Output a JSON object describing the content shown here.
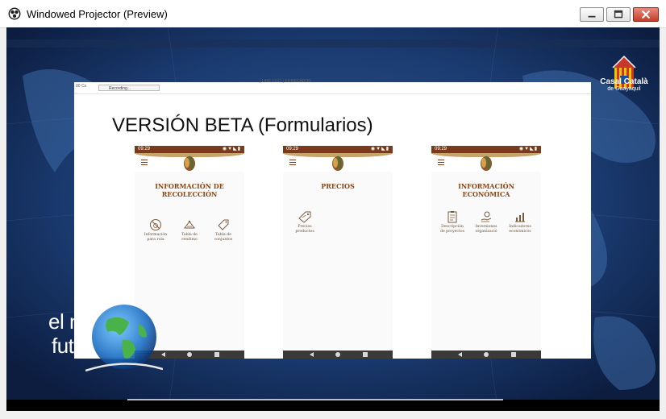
{
  "window": {
    "title": "Windowed Projector (Preview)",
    "controls": [
      "minimize-icon",
      "maximize-icon",
      "close-icon"
    ]
  },
  "slide": {
    "toolbar": {
      "left_text": "00 Cs",
      "recording_label": "Recording...",
      "top_text": "| LINE 11111 | F0 RECADOR"
    },
    "title": "VERSIÓN BETA (Formularios)"
  },
  "phones": [
    {
      "status_time": "09:29",
      "screen_title_line1": "INFORMACIÓN DE",
      "screen_title_line2": "RECOLECCIÓN",
      "items": [
        {
          "icon": "no-fruit-icon",
          "line1": "Información",
          "line2": "para rola"
        },
        {
          "icon": "scale-icon",
          "line1": "Tabla de",
          "line2": "rendimo"
        },
        {
          "icon": "tag-icon",
          "line1": "Tabla de",
          "line2": "conjuntos"
        }
      ]
    },
    {
      "status_time": "09:29",
      "screen_title_line1": "PRECIOS",
      "screen_title_line2": "",
      "items": [
        {
          "icon": "price-tag-icon",
          "line1": "Precios",
          "line2": "productos"
        }
      ]
    },
    {
      "status_time": "09:29",
      "screen_title_line1": "INFORMACIÓN ECONÓMICA",
      "screen_title_line2": "",
      "items": [
        {
          "icon": "clipboard-icon",
          "line1": "Descripción",
          "line2": "de proyectos"
        },
        {
          "icon": "hand-coin-icon",
          "line1": "Inversiones",
          "line2": "organizació"
        },
        {
          "icon": "chart-icon",
          "line1": "Indicadores",
          "line2": "económicos"
        }
      ]
    }
  ],
  "overlay": {
    "casal_name": "Casal Català",
    "casal_sub": "de Guayaquil",
    "show_name_line1": "el nostre",
    "show_name_line2": "futur"
  },
  "colors": {
    "status_bar": "#7a3b1c",
    "title_brown": "#8b4513",
    "background_blue": "#1f3f73"
  }
}
